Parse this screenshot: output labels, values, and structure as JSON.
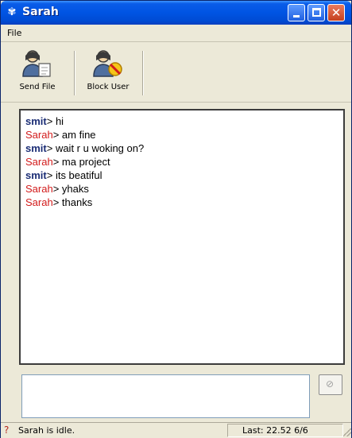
{
  "window": {
    "title": "Sarah",
    "colors": {
      "titlebar": "#0054e3",
      "close": "#c5401e",
      "smit": "#1b2d75",
      "sarah": "#d21b1b"
    }
  },
  "menu": {
    "file": "File"
  },
  "toolbar": {
    "send_file": {
      "label": "Send File",
      "icon": "send-file-icon"
    },
    "block_user": {
      "label": "Block User",
      "icon": "block-user-icon"
    }
  },
  "chat": {
    "messages": [
      {
        "sender": "smit",
        "text": "> hi"
      },
      {
        "sender": "Sarah",
        "text": "> am fine"
      },
      {
        "sender": "smit",
        "text": "> wait r u woking on?"
      },
      {
        "sender": "Sarah",
        "text": "> ma project"
      },
      {
        "sender": "smit",
        "text": "> its beatiful"
      },
      {
        "sender": "Sarah",
        "text": "> yhaks"
      },
      {
        "sender": "Sarah",
        "text": "> thanks"
      }
    ]
  },
  "input": {
    "value": ""
  },
  "status": {
    "left": "Sarah is idle.",
    "right": "Last: 22.52 6/6",
    "icon": "idle-status-icon"
  }
}
